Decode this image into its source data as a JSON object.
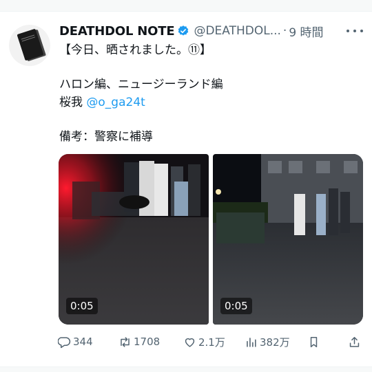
{
  "tweet": {
    "author_name": "DEATHDOL NOTE",
    "handle": "@DEATHDOL...",
    "separator": "·",
    "time": "9 時間",
    "line1": "【今日、晒されました。⑪】",
    "line2": "ハロン編、ニュージーランド編",
    "line3_prefix": "桜我 ",
    "mention": "@o_ga24t",
    "line4": "備考：警察に補導"
  },
  "media": [
    {
      "duration": "0:05"
    },
    {
      "duration": "0:05"
    }
  ],
  "actions": {
    "replies": "344",
    "reposts": "1708",
    "likes": "2.1万",
    "views": "382万"
  },
  "icons": [
    "more-icon",
    "verified-icon",
    "reply-icon",
    "repost-icon",
    "like-icon",
    "views-icon",
    "bookmark-icon",
    "share-icon"
  ],
  "colors": {
    "accent": "#1d9bf0",
    "muted": "#536471",
    "text": "#0f1419"
  }
}
